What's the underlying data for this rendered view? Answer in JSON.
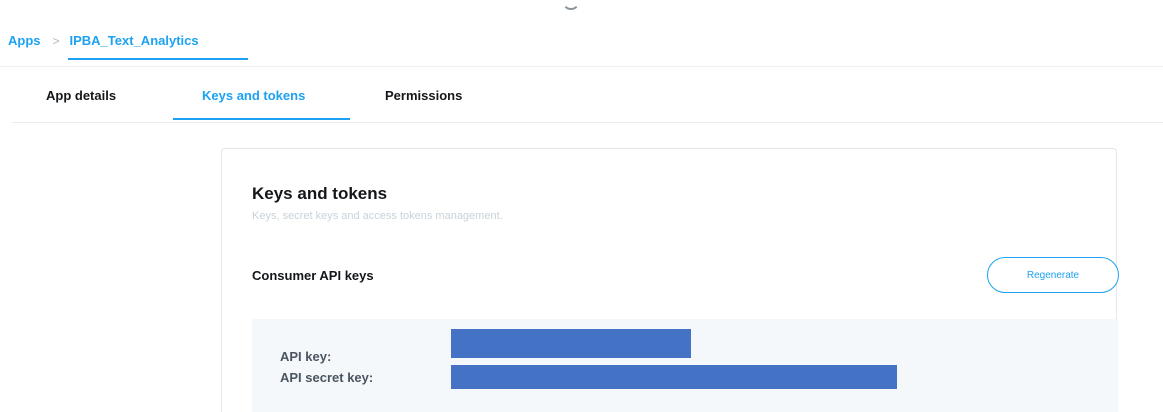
{
  "breadcrumb": {
    "root": "Apps",
    "separator": ">",
    "current": "IPBA_Text_Analytics"
  },
  "tabs": [
    {
      "label": "App details",
      "active": false
    },
    {
      "label": "Keys and tokens",
      "active": true
    },
    {
      "label": "Permissions",
      "active": false
    }
  ],
  "card": {
    "title": "Keys and tokens",
    "subtitle": "Keys, secret keys and access tokens management.",
    "section_title": "Consumer API keys",
    "regenerate_label": "Regenerate",
    "keys": [
      {
        "label": "API key:",
        "value_redacted": true
      },
      {
        "label": "API secret key:",
        "value_redacted": true
      }
    ]
  },
  "colors": {
    "accent": "#1da1f2",
    "redaction": "#4472c4",
    "keys_box_bg": "#f5f8fa",
    "border": "#e1e8ed"
  }
}
